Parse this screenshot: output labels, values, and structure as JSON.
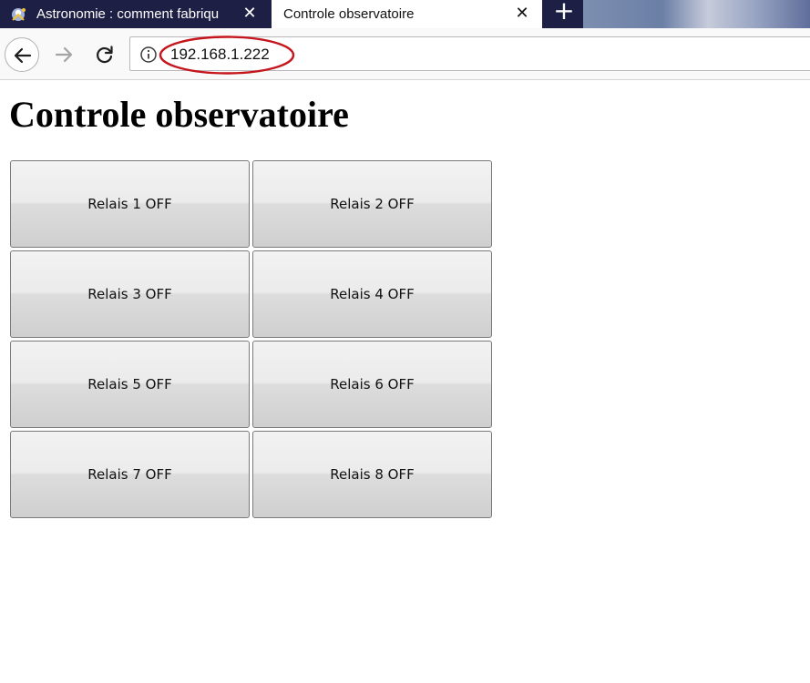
{
  "browser": {
    "tabs": [
      {
        "title": "Astronomie : comment fabriqu",
        "state": "inactive",
        "icon": "astronaut-favicon-icon"
      },
      {
        "title": "Controle observatoire",
        "state": "active"
      }
    ],
    "url": "192.168.1.222",
    "highlight_color": "#c4161c"
  },
  "page": {
    "title": "Controle observatoire",
    "relays": [
      {
        "label": "Relais 1 OFF"
      },
      {
        "label": "Relais 2 OFF"
      },
      {
        "label": "Relais 3 OFF"
      },
      {
        "label": "Relais 4 OFF"
      },
      {
        "label": "Relais 5 OFF"
      },
      {
        "label": "Relais 6 OFF"
      },
      {
        "label": "Relais 7 OFF"
      },
      {
        "label": "Relais 8 OFF"
      }
    ]
  }
}
